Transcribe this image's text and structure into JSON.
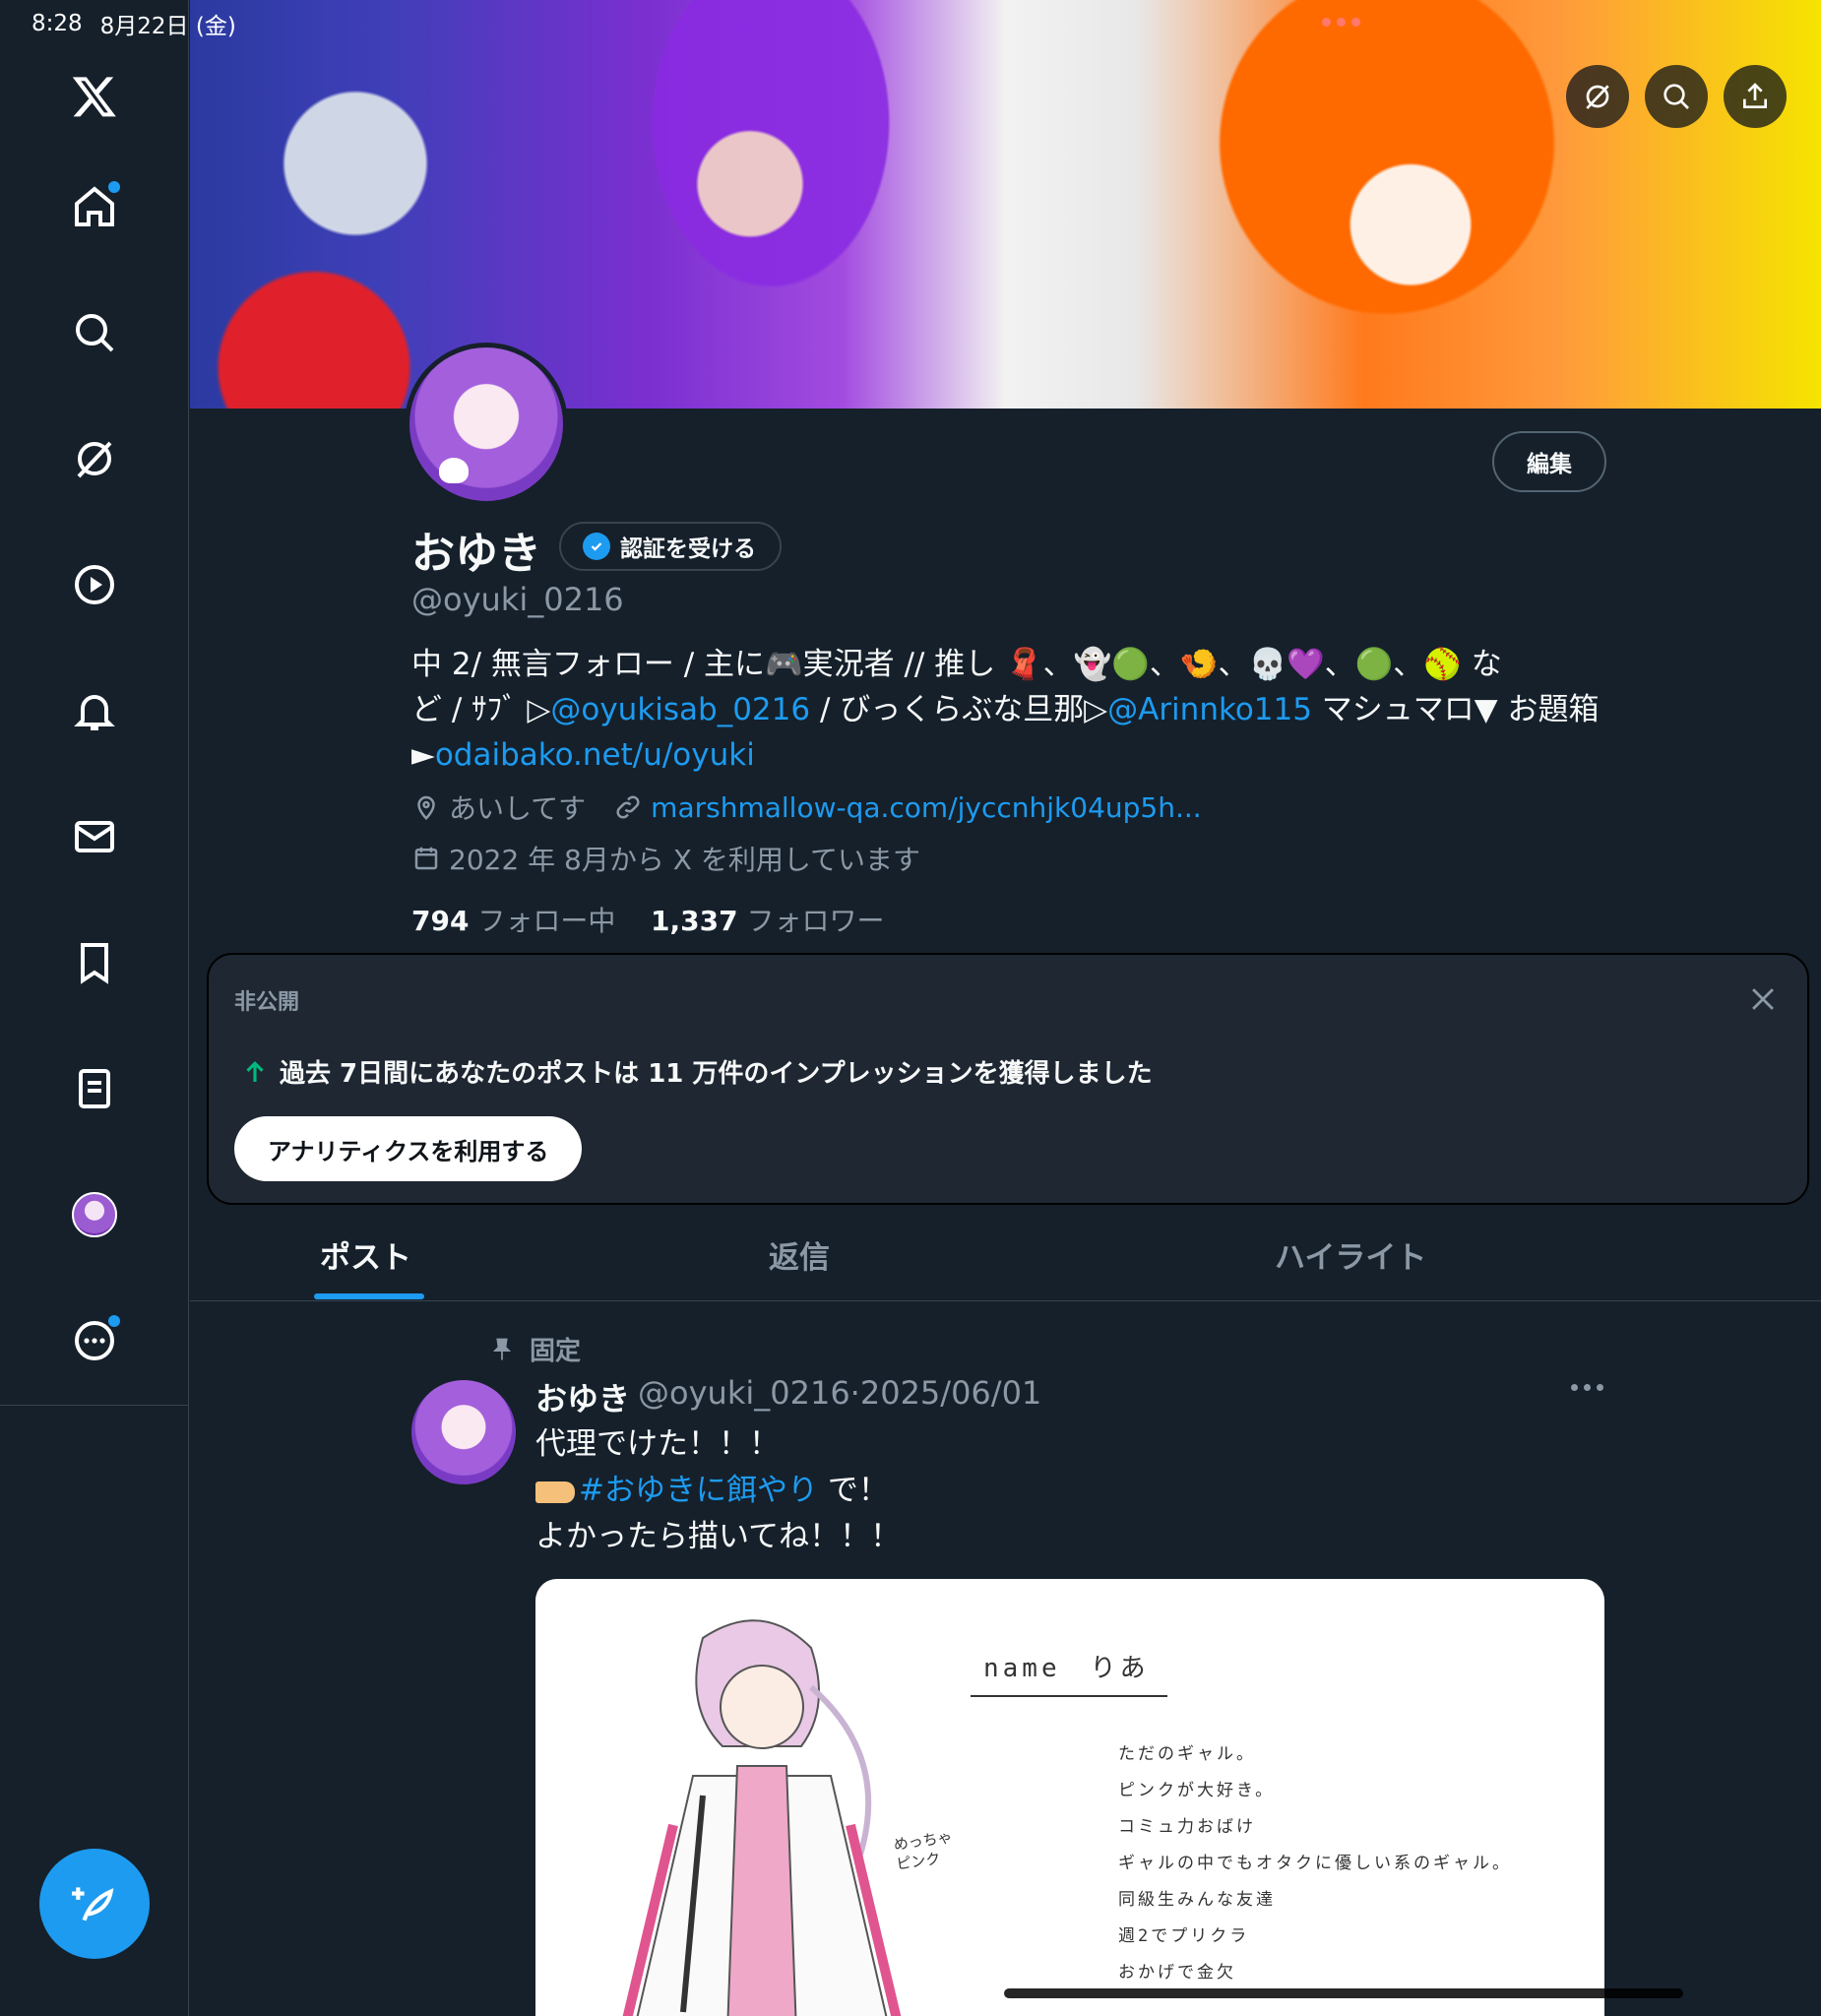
{
  "status": {
    "time": "8:28",
    "date": "8月22日 (金)"
  },
  "profile": {
    "name": "おゆき",
    "verify_label": "認証を受ける",
    "handle": "@oyuki_0216",
    "edit_label": "編集",
    "bio": {
      "line1": "中 2/ 無言フォロー / 主に🎮実況者 // 推し 🧣、👻🟢、🍤、💀💜、🟢、🥎 な",
      "line2_prefix": "ど / ｻﾌﾞ ▷",
      "link1": "@oyukisab_0216",
      "line2_mid": " / びっくらぶな旦那▷",
      "link2": "@Arinnko115",
      "line2_suffix": " マシュマロ▼ お題箱",
      "line3_prefix": "►",
      "link3": "odaibako.net/u/oyuki"
    },
    "location": "あいしてす",
    "website": "marshmallow-qa.com/jyccnhjk04up5h...",
    "joined": "2022 年 8月から X を利用しています",
    "following_count": "794",
    "following_label": "フォロー中",
    "followers_count": "1,337",
    "followers_label": "フォロワー"
  },
  "analytics_card": {
    "private_label": "非公開",
    "message": "過去 7日間にあなたのポストは 11 万件のインプレッションを獲得しました",
    "cta_label": "アナリティクスを利用する"
  },
  "tabs": [
    {
      "label": "ポスト",
      "active": true
    },
    {
      "label": "返信",
      "active": false
    },
    {
      "label": "ハイライト",
      "active": false
    }
  ],
  "post": {
    "pinned_label": "固定",
    "author": "おゆき",
    "handle_date": "@oyuki_0216·2025/06/01",
    "line1": "代理でけた！！！",
    "hashtag": "#おゆきに餌やり",
    "line2_suffix": " で！",
    "line3": "よかったら描いてね！！！",
    "image": {
      "name_text": "name　りあ",
      "note": "めっちゃ\nピンク",
      "lines": [
        "ただのギャル。",
        "ピンクが大好き。",
        "コミュ力おばけ",
        "ギャルの中でもオタクに優しい系のギャル。",
        "同級生みんな友達",
        "週2でプリクラ",
        "おかげで金欠"
      ]
    }
  },
  "colors": {
    "accent": "#1d9bf0",
    "background": "#15202b",
    "muted": "#8b98a5"
  }
}
